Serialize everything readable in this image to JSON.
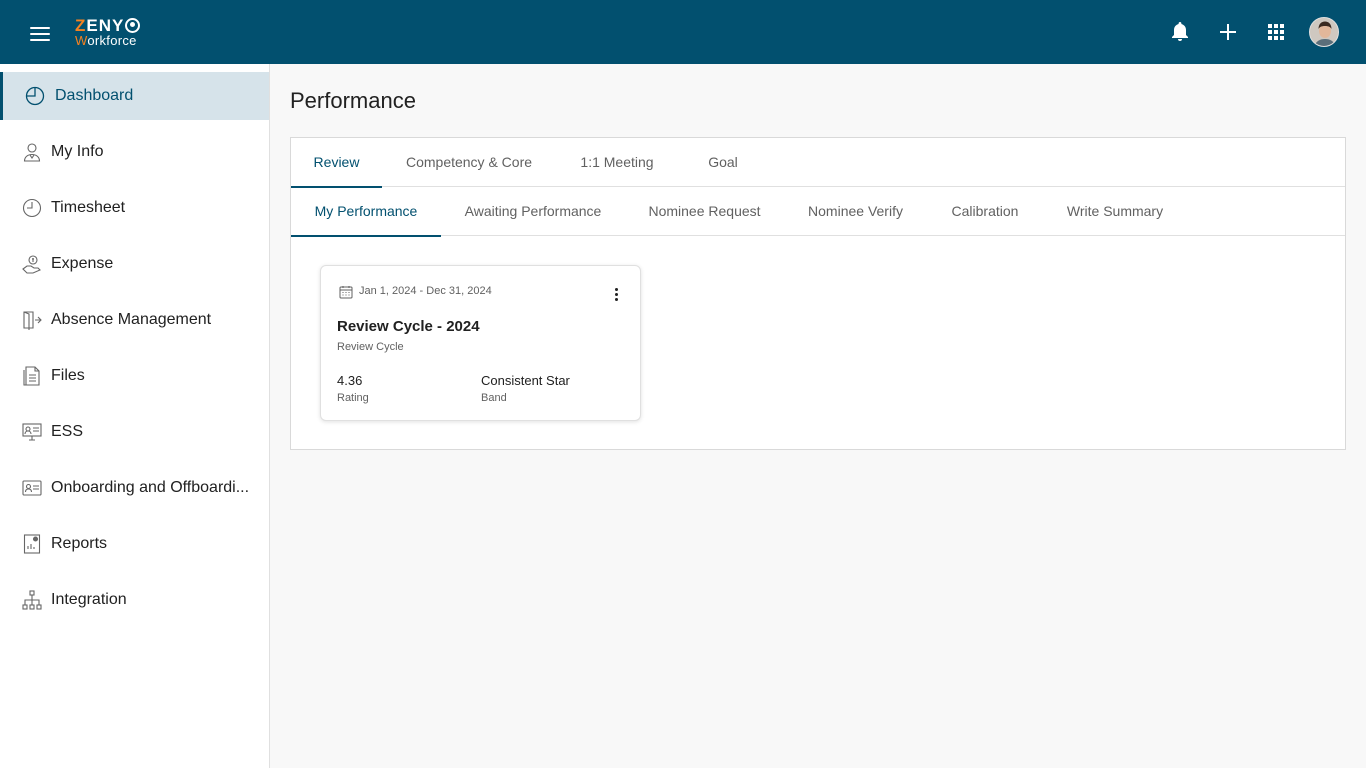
{
  "brand": {
    "logo_top": "ZENY",
    "logo_bottom": "Workforce"
  },
  "header": {
    "icons": [
      "bell-icon",
      "plus-icon",
      "apps-grid-icon",
      "avatar"
    ]
  },
  "sidebar": {
    "items": [
      {
        "label": "Dashboard",
        "icon": "dashboard-icon",
        "active": true
      },
      {
        "label": "My Info",
        "icon": "person-icon"
      },
      {
        "label": "Timesheet",
        "icon": "clock-icon"
      },
      {
        "label": "Expense",
        "icon": "money-hand-icon"
      },
      {
        "label": "Absence Management",
        "icon": "door-exit-icon"
      },
      {
        "label": "Files",
        "icon": "file-icon"
      },
      {
        "label": "ESS",
        "icon": "monitor-person-icon"
      },
      {
        "label": "Onboarding and Offboardi...",
        "icon": "id-card-icon"
      },
      {
        "label": "Reports",
        "icon": "report-icon"
      },
      {
        "label": "Integration",
        "icon": "hierarchy-icon"
      }
    ]
  },
  "page": {
    "title": "Performance"
  },
  "tabs_primary": [
    {
      "label": "Review",
      "active": true
    },
    {
      "label": "Competency & Core"
    },
    {
      "label": "1:1 Meeting"
    },
    {
      "label": "Goal"
    }
  ],
  "tabs_secondary": [
    {
      "label": "My Performance",
      "active": true
    },
    {
      "label": "Awaiting Performance"
    },
    {
      "label": "Nominee Request"
    },
    {
      "label": "Nominee Verify"
    },
    {
      "label": "Calibration"
    },
    {
      "label": "Write Summary"
    }
  ],
  "review_card": {
    "date_range": "Jan 1, 2024 - Dec 31, 2024",
    "title": "Review Cycle - 2024",
    "subtitle": "Review Cycle",
    "rating_value": "4.36",
    "rating_label": "Rating",
    "band_value": "Consistent Star",
    "band_label": "Band"
  },
  "colors": {
    "primary": "#02506f",
    "accent": "#f58220",
    "active_bg": "#d6e3ea"
  }
}
